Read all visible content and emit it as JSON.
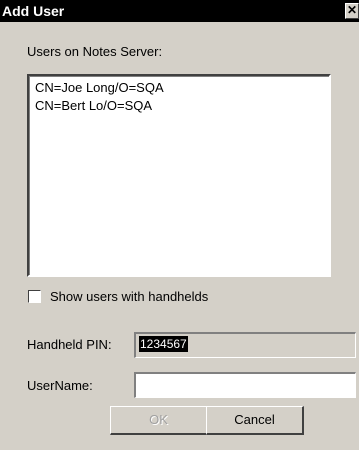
{
  "window": {
    "title": "Add User",
    "close_glyph": "✕"
  },
  "users_label": "Users on Notes Server:",
  "users": [
    "CN=Joe Long/O=SQA",
    "CN=Bert Lo/O=SQA"
  ],
  "show_handhelds": {
    "label": "Show users with handhelds",
    "checked": false
  },
  "handheld_pin": {
    "label": "Handheld PIN:",
    "value": "1234567"
  },
  "username": {
    "label": "UserName:",
    "value": ""
  },
  "buttons": {
    "ok_label": "OK",
    "ok_enabled": false,
    "cancel_label": "Cancel"
  }
}
